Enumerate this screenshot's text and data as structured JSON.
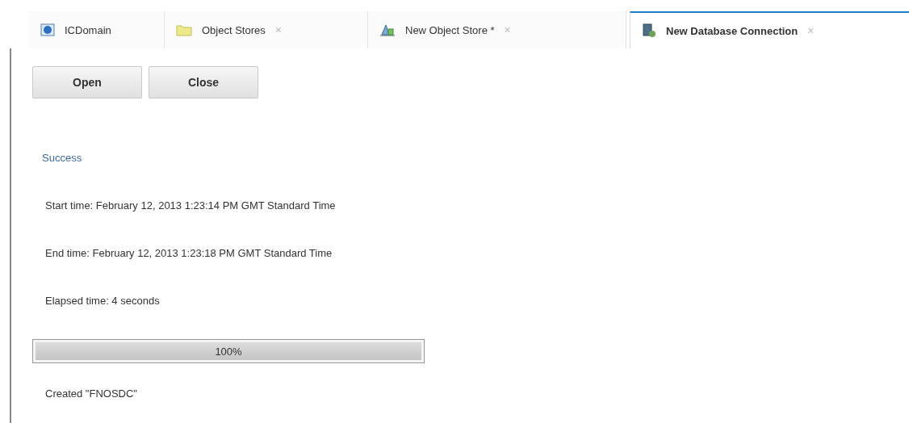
{
  "tabs": [
    {
      "label": "ICDomain",
      "kind": "globe",
      "closable": false,
      "selected": false
    },
    {
      "label": "Object Stores",
      "kind": "folder",
      "closable": true,
      "selected": false
    },
    {
      "label": "New Object Store *",
      "kind": "store",
      "closable": true,
      "selected": false
    },
    {
      "label": "New Database Connection",
      "kind": "database",
      "closable": true,
      "selected": true
    }
  ],
  "close_glyph": "×",
  "buttons": [
    "Open",
    "Close"
  ],
  "status": "Success",
  "details": [
    "Start time: February 12, 2013 1:23:14 PM GMT Standard Time",
    "End time: February 12, 2013 1:23:18 PM GMT Standard Time",
    "Elapsed time: 4 seconds"
  ],
  "progress": {
    "level": 1,
    "label": "100%"
  },
  "result": "Created \"FNOSDC\""
}
